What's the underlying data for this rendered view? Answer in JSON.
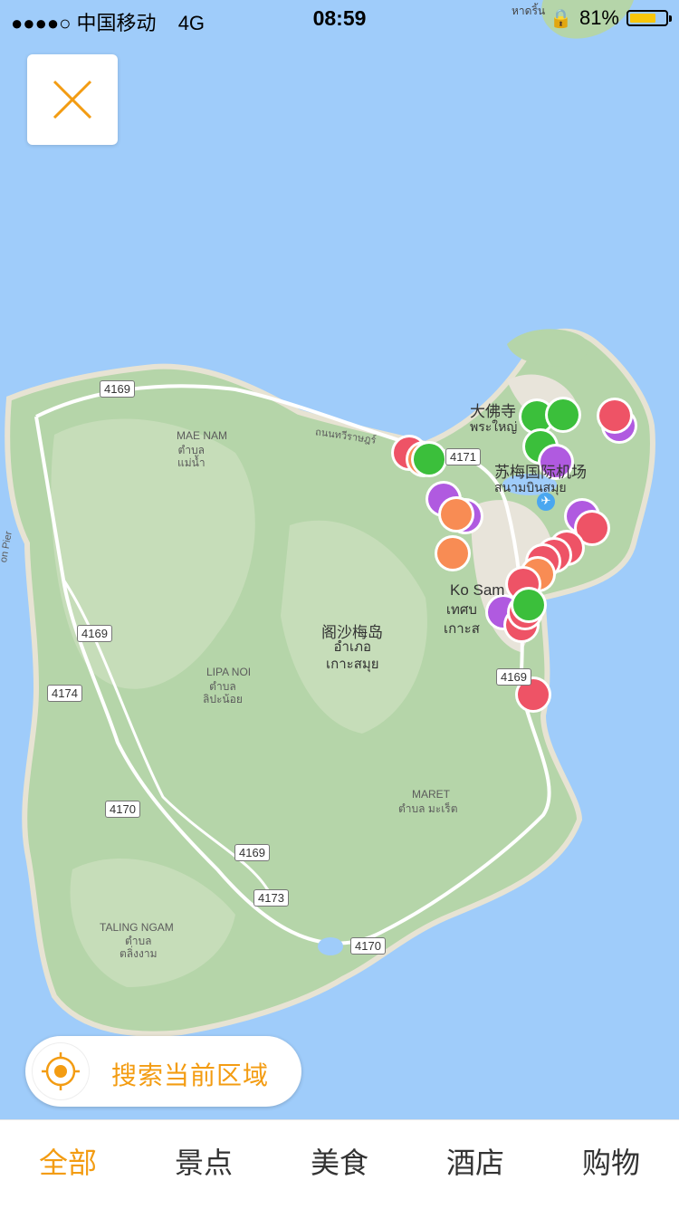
{
  "status_bar": {
    "carrier": "●●●●○ 中国移动",
    "network": "4G",
    "time": "08:59",
    "battery": "81%",
    "battery_level": 0.81,
    "battery_color": "#f7c60a"
  },
  "map": {
    "labels": {
      "mae_nam": "MAE NAM",
      "mae_nam_thai": "ตำบล\nแม่น้ำ",
      "big_buddha": "大佛寺",
      "big_buddha_thai": "พระใหญ่",
      "airport": "苏梅国际机场",
      "airport_thai": "สนามบินสมุย",
      "ko_samui": "Ko Sam",
      "ko_samui_thai": "เทศบ\nเกาะส",
      "district_cn": "阁沙梅岛",
      "district_thai": "อำเภอ\nเกาะสมุย",
      "lipa_noi": "LIPA NOI",
      "lipa_noi_thai": "ตำบล\nลิปะน้อย",
      "maret": "MARET",
      "maret_thai": "ตำบล มะเร็ต",
      "taling_ngam": "TALING NGAM",
      "taling_ngam_thai": "ตำบล\nตลิ่งงาม",
      "road_thai": "ถนนทวีราษฎร์",
      "pier": "on Pier",
      "hat_rin": "หาดริ้น"
    },
    "road_badges": [
      "4169",
      "4169",
      "4174",
      "4170",
      "4169",
      "4173",
      "4170",
      "4169",
      "4171"
    ],
    "marker_colors": {
      "red": "#ee5366",
      "orange": "#f88c54",
      "purple": "#b05ae0",
      "green": "#3bbf3b"
    }
  },
  "close_button": {
    "icon": "close-icon",
    "color": "#f39c12"
  },
  "search_button": {
    "label": "搜索当前区域",
    "icon": "locate-icon"
  },
  "tabs": [
    {
      "label": "全部",
      "active": true
    },
    {
      "label": "景点",
      "active": false
    },
    {
      "label": "美食",
      "active": false
    },
    {
      "label": "酒店",
      "active": false
    },
    {
      "label": "购物",
      "active": false
    }
  ],
  "accent_color": "#f39c12"
}
